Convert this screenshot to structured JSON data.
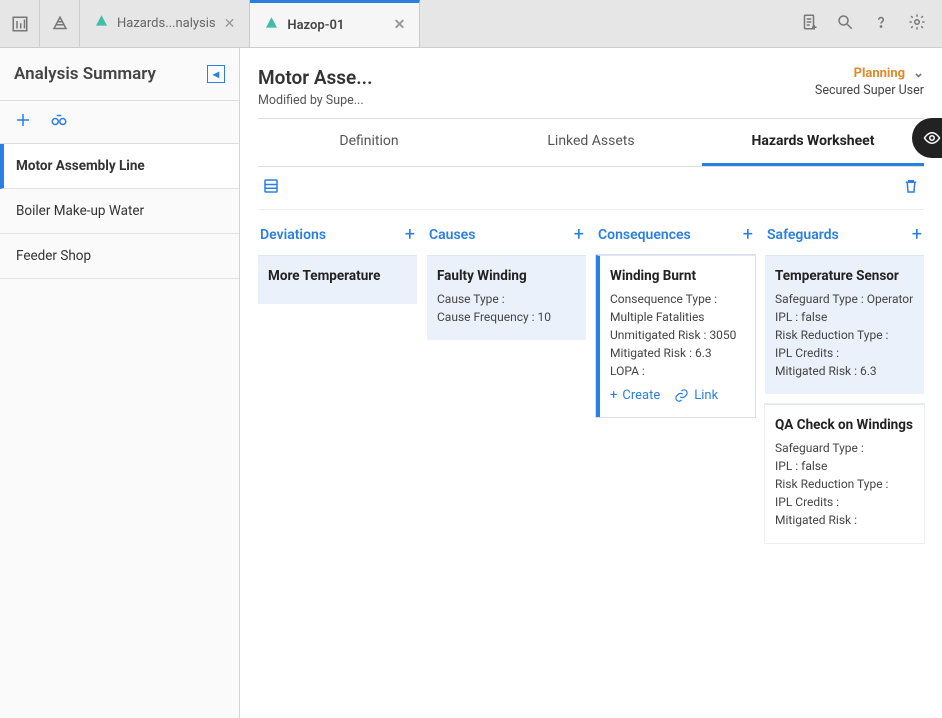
{
  "tabs": [
    {
      "label": "Hazards...nalysis",
      "active": false
    },
    {
      "label": "Hazop-01",
      "active": true
    }
  ],
  "sidebar": {
    "title": "Analysis Summary",
    "items": [
      {
        "label": "Motor Assembly Line",
        "active": true
      },
      {
        "label": "Boiler Make-up Water",
        "active": false
      },
      {
        "label": "Feeder Shop",
        "active": false
      }
    ]
  },
  "main": {
    "title": "Motor Asse...",
    "subtitle": "Modified by Supe...",
    "status": {
      "label": "Planning",
      "user": "Secured Super User"
    },
    "subtabs": {
      "definition": "Definition",
      "linked": "Linked Assets",
      "worksheet": "Hazards Worksheet"
    }
  },
  "colHeaders": {
    "deviations": "Deviations",
    "causes": "Causes",
    "consequences": "Consequences",
    "safeguards": "Safeguards"
  },
  "deviations": [
    {
      "title": "More Temperature"
    }
  ],
  "causes": [
    {
      "title": "Faulty Winding",
      "rows": [
        "Cause Type :",
        "Cause Frequency : 10"
      ]
    }
  ],
  "consequences": [
    {
      "title": "Winding Burnt",
      "rows": [
        "Consequence Type : Multiple Fatalities",
        "Unmitigated Risk : 3050",
        "Mitigated Risk : 6.3",
        "LOPA :"
      ],
      "actions": {
        "create": "Create",
        "link": "Link"
      },
      "selected": true
    }
  ],
  "safeguards": [
    {
      "title": "Temperature Sensor",
      "rows": [
        "Safeguard Type : Operator",
        "IPL : false",
        "Risk Reduction Type :",
        "IPL Credits :",
        "Mitigated Risk : 6.3"
      ]
    },
    {
      "title": "QA Check on Windings",
      "rows": [
        "Safeguard Type :",
        "IPL : false",
        "Risk Reduction Type :",
        "IPL Credits :",
        "Mitigated Risk :"
      ]
    }
  ]
}
